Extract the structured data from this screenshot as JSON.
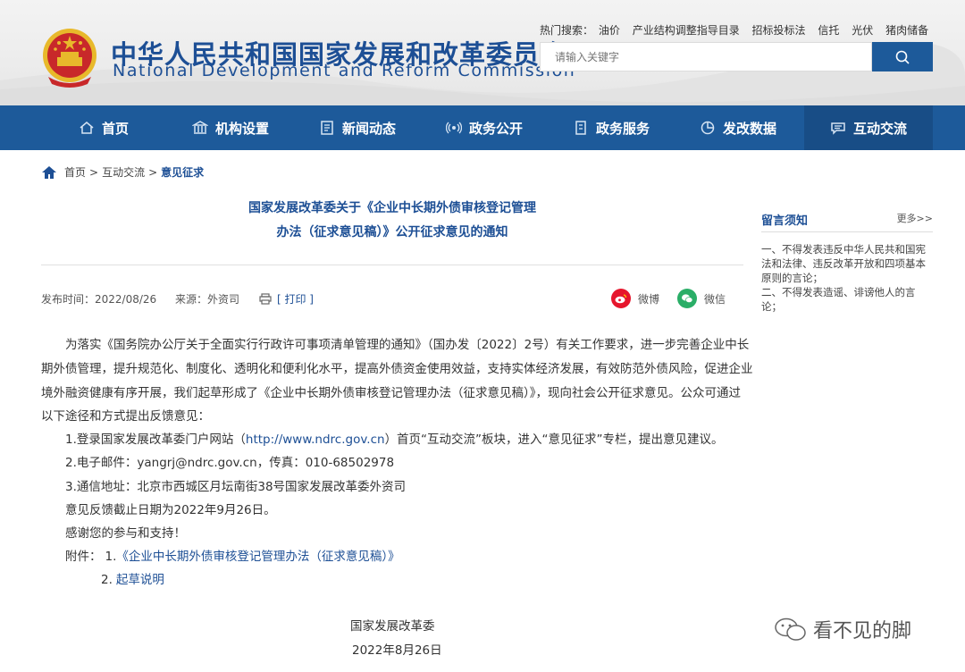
{
  "header": {
    "title_cn": "中华人民共和国国家发展和改革委员会",
    "title_en": "National Development and Reform Commission",
    "hot_search_label": "热门搜索：",
    "hot_search_terms": [
      "油价",
      "产业结构调整指导目录",
      "招标投标法",
      "信托",
      "光伏",
      "猪肉储备"
    ],
    "search_placeholder": "请输入关键字"
  },
  "nav": {
    "items": [
      {
        "label": "首页",
        "icon": "home-icon"
      },
      {
        "label": "机构设置",
        "icon": "building-icon"
      },
      {
        "label": "新闻动态",
        "icon": "news-icon"
      },
      {
        "label": "政务公开",
        "icon": "broadcast-icon"
      },
      {
        "label": "政务服务",
        "icon": "document-icon"
      },
      {
        "label": "发改数据",
        "icon": "pie-chart-icon"
      },
      {
        "label": "互动交流",
        "icon": "chat-icon"
      }
    ],
    "active": "互动交流"
  },
  "breadcrumb": {
    "home": "首页",
    "sep1": ">",
    "level2": "互动交流",
    "sep2": ">",
    "current": "意见征求"
  },
  "article": {
    "title_line1": "国家发展改革委关于《企业中长期外债审核登记管理",
    "title_line2": "办法（征求意见稿）》公开征求意见的通知",
    "publish_time": "发布时间：2022/08/26",
    "source": "来源：外资司",
    "print_label": "[ 打印 ]",
    "share_weibo": "微博",
    "share_wechat": "微信",
    "para_lines": [
      "为落实《国务院办公厅关于全面实行行政许可事项清单管理的通知》（国办发〔2022〕2号）有关工作要求，进一步完善企业中长",
      "期外债管理，提升规范化、制度化、透明化和便利化水平，提高外债资金使用效益，支持实体经济发展，有效防范外债风险，促进企业",
      "境外融资健康有序开展，我们起草形成了《企业中长期外债审核登记管理办法（征求意见稿）》，现向社会公开征求意见。公众可通过",
      "以下途径和方式提出反馈意见："
    ],
    "item1_prefix": "1.登录国家发展改革委门户网站（",
    "item1_link": "http://www.ndrc.gov.cn",
    "item1_suffix": "）首页“互动交流”板块，进入“意见征求”专栏，提出意见建议。",
    "item2": "2.电子邮件：yangrj@ndrc.gov.cn，传真：010-68502978",
    "item3": "3.通信地址：北京市西城区月坛南街38号国家发展改革委外资司",
    "deadline": "意见反馈截止日期为2022年9月26日。",
    "thanks": "感谢您的参与和支持！",
    "attachment_label": "附件：",
    "attachment1_num": "1.",
    "attachment1": "《企业中长期外债审核登记管理办法（征求意见稿）》",
    "attachment2_num": "2.",
    "attachment2": "起草说明",
    "signature": "国家发展改革委",
    "date": "2022年8月26日"
  },
  "sidebar": {
    "title": "留言须知",
    "more": "更多>>",
    "lines": [
      "一、不得发表违反中华人民共和国宪",
      "法和法律、违反改革开放和四项基本",
      "原则的言论；",
      "二、不得发表造谣、诽谤他人的言",
      "论；"
    ]
  },
  "watermark": {
    "text": "看不见的脚"
  }
}
